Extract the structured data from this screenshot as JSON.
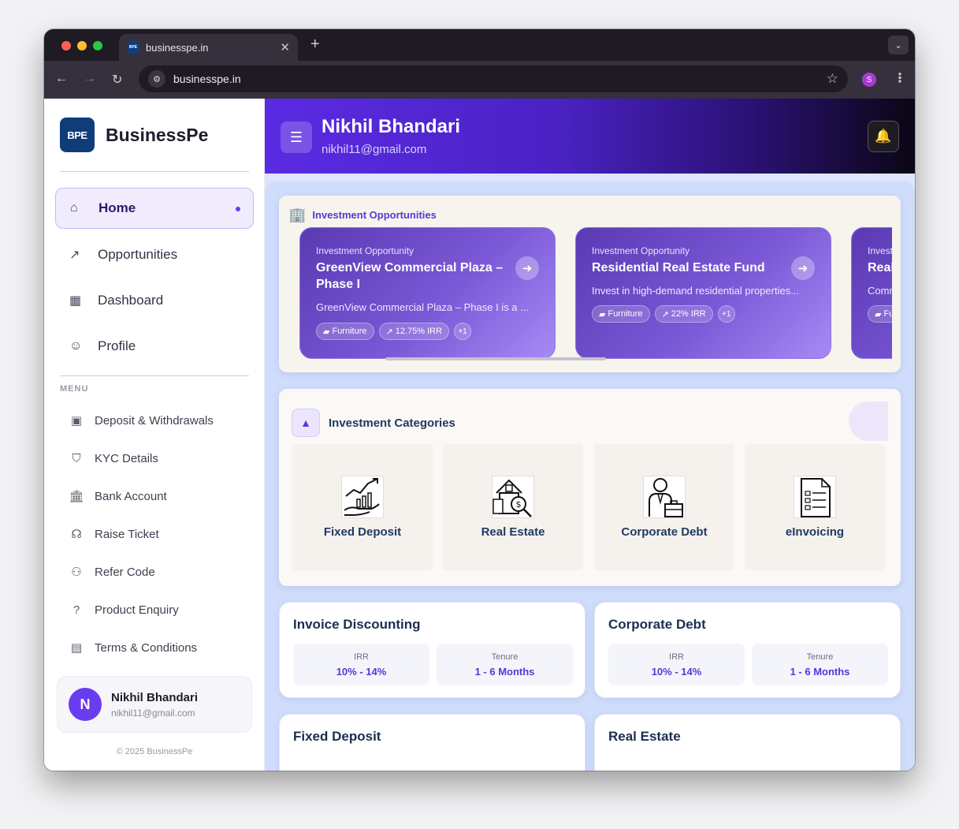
{
  "browser": {
    "tab_title": "businesspe.in",
    "tab_favicon_text": "BPE",
    "url": "businesspe.in",
    "profile_initial": "S",
    "icons": {
      "back": "arrow-left-icon",
      "forward": "arrow-right-icon",
      "reload": "reload-icon",
      "bookmark": "star-icon",
      "menu": "kebab-icon"
    }
  },
  "sidebar": {
    "logo_text": "BPE",
    "brand": "BusinessPe",
    "nav": [
      {
        "label": "Home",
        "icon": "home-icon",
        "active": true
      },
      {
        "label": "Opportunities",
        "icon": "trending-up-icon",
        "active": false
      },
      {
        "label": "Dashboard",
        "icon": "dashboard-icon",
        "active": false
      },
      {
        "label": "Profile",
        "icon": "user-icon",
        "active": false
      }
    ],
    "menu_heading": "MENU",
    "menu": [
      {
        "label": "Deposit & Withdrawals",
        "icon": "wallet-icon"
      },
      {
        "label": "KYC Details",
        "icon": "shield-check-icon"
      },
      {
        "label": "Bank Account",
        "icon": "bank-icon"
      },
      {
        "label": "Raise Ticket",
        "icon": "headset-icon"
      },
      {
        "label": "Refer Code",
        "icon": "users-icon"
      },
      {
        "label": "Product Enquiry",
        "icon": "help-circle-icon"
      },
      {
        "label": "Terms & Conditions",
        "icon": "document-icon"
      }
    ],
    "user": {
      "initial": "N",
      "name": "Nikhil Bhandari",
      "email": "nikhil11@gmail.com"
    },
    "copyright": "© 2025 BusinessPe"
  },
  "header": {
    "name": "Nikhil Bhandari",
    "email": "nikhil11@gmail.com"
  },
  "opportunities": {
    "title": "Investment Opportunities",
    "cards": [
      {
        "kicker": "Investment Opportunity",
        "title": "GreenView Commercial Plaza – Phase I",
        "description": "GreenView Commercial Plaza – Phase I is a ...",
        "chips": [
          "Furniture",
          "12.75% IRR",
          "+1"
        ]
      },
      {
        "kicker": "Investment Opportunity",
        "title": "Residential Real Estate Fund",
        "description": "Invest in high-demand residential properties...",
        "chips": [
          "Furniture",
          "22% IRR",
          "+1"
        ]
      },
      {
        "kicker": "Invest",
        "title": "Real",
        "description": "Comm",
        "chips": [
          "Fu"
        ]
      }
    ]
  },
  "categories": {
    "title": "Investment Categories",
    "items": [
      {
        "label": "Fixed Deposit",
        "icon": "growth-chart-hand-icon"
      },
      {
        "label": "Real Estate",
        "icon": "house-search-icon"
      },
      {
        "label": "Corporate Debt",
        "icon": "businessman-briefcase-icon"
      },
      {
        "label": "eInvoicing",
        "icon": "invoice-document-icon"
      }
    ]
  },
  "products": [
    {
      "title": "Invoice Discounting",
      "metrics": [
        {
          "label": "IRR",
          "value": "10% - 14%"
        },
        {
          "label": "Tenure",
          "value": "1 - 6 Months"
        }
      ]
    },
    {
      "title": "Corporate Debt",
      "metrics": [
        {
          "label": "IRR",
          "value": "10% - 14%"
        },
        {
          "label": "Tenure",
          "value": "1 - 6 Months"
        }
      ]
    },
    {
      "title": "Fixed Deposit",
      "metrics": []
    },
    {
      "title": "Real Estate",
      "metrics": []
    }
  ],
  "colors": {
    "accent": "#6a3cf0",
    "brand_logo": "#0f3d7a",
    "hero_start": "#5b2be3",
    "hero_end": "#0b0614"
  }
}
